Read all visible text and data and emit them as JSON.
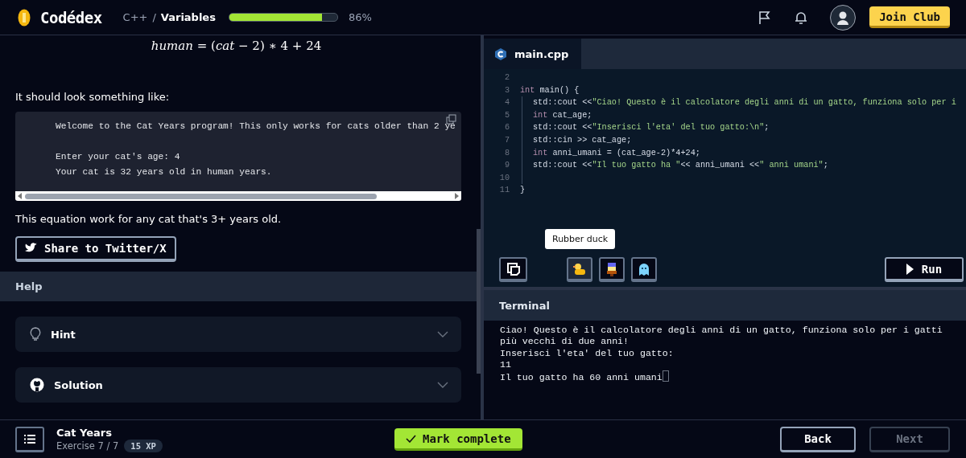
{
  "header": {
    "logo": "Codédex",
    "breadcrumb": {
      "course": "C++",
      "separator": "/",
      "lesson": "Variables"
    },
    "progress": {
      "level": 0.86,
      "reading": "86%"
    },
    "join_button": "Join Club"
  },
  "lesson": {
    "formula": "*human* = (*cat* − 2) ∗ 4 + 24",
    "intro": "It should look something like:",
    "sample_output": [
      [
        "Welcome to the Cat Years program! This only works for cats older than 2 ye"
      ],
      [
        "Enter your cat's age: 4",
        "Your cat is 32 years old in human years."
      ]
    ],
    "note": "This equation work for any cat that's 3+ years old.",
    "share_button": "Share to Twitter/X",
    "help": {
      "title": "Help",
      "items": [
        {
          "kind": "hint",
          "label": "Hint",
          "expanded": false
        },
        {
          "kind": "solution",
          "label": "Solution",
          "expanded": false
        }
      ]
    }
  },
  "editor": {
    "tabs": [
      {
        "label": "main.cpp",
        "selected": true
      }
    ],
    "lines": [
      {
        "number": "2"
      },
      {
        "number": "3",
        "segments": [
          {
            "kind": "keyword",
            "text": "int"
          },
          {
            "kind": "plain",
            "text": " main() {"
          }
        ]
      },
      {
        "number": "4",
        "indented": true,
        "segments": [
          {
            "kind": "plain",
            "text": "std::cout <<"
          },
          {
            "kind": "string",
            "text": "\"Ciao! Questo è il calcolatore degli anni di un gatto, funziona solo per i"
          }
        ]
      },
      {
        "number": "5",
        "indented": true,
        "segments": [
          {
            "kind": "keyword",
            "text": "int"
          },
          {
            "kind": "plain",
            "text": " cat_age;"
          }
        ]
      },
      {
        "number": "6",
        "indented": true,
        "segments": [
          {
            "kind": "plain",
            "text": "std::cout <<"
          },
          {
            "kind": "string",
            "text": "\"Inserisci l'eta' del tuo gatto:\\n\""
          },
          {
            "kind": "plain",
            "text": ";"
          }
        ]
      },
      {
        "number": "7",
        "indented": true,
        "segments": [
          {
            "kind": "plain",
            "text": "std::cin >> cat_age;"
          }
        ]
      },
      {
        "number": "8",
        "indented": true,
        "segments": [
          {
            "kind": "keyword",
            "text": "int"
          },
          {
            "kind": "plain",
            "text": " anni_umani = (cat_age-2)*4+24;"
          }
        ]
      },
      {
        "number": "9",
        "indented": true,
        "segments": [
          {
            "kind": "plain",
            "text": "std::cout <<"
          },
          {
            "kind": "string",
            "text": "\"Il tuo gatto ha \""
          },
          {
            "kind": "plain",
            "text": "<< anni_umani <<"
          },
          {
            "kind": "string",
            "text": "\" anni umani\""
          },
          {
            "kind": "plain",
            "text": ";"
          }
        ]
      },
      {
        "number": "10",
        "indented": true
      },
      {
        "number": "11",
        "segments": [
          {
            "kind": "plain",
            "text": "}"
          }
        ]
      }
    ],
    "tools": [
      {
        "kind": "copy",
        "hovered": false
      },
      {
        "kind": "duck",
        "hovered": true,
        "tooltip": "Rubber duck"
      },
      {
        "kind": "character",
        "hovered": false
      },
      {
        "kind": "ghost",
        "hovered": false
      }
    ],
    "run_button": "Run"
  },
  "terminal": {
    "title": "Terminal",
    "output": [
      "Ciao! Questo è il calcolatore degli anni di un gatto, funziona solo per i gatti",
      "più vecchi di due anni!",
      "Inserisci l'eta' del tuo gatto:",
      "11",
      "Il tuo gatto ha 60 anni umani"
    ]
  },
  "footer": {
    "title": "Cat Years",
    "exercise": "Exercise 7 / 7",
    "xp": "15 XP",
    "mark_button": "Mark complete",
    "back_button": {
      "label": "Back",
      "disabled": false
    },
    "next_button": {
      "label": "Next",
      "disabled": true
    }
  }
}
